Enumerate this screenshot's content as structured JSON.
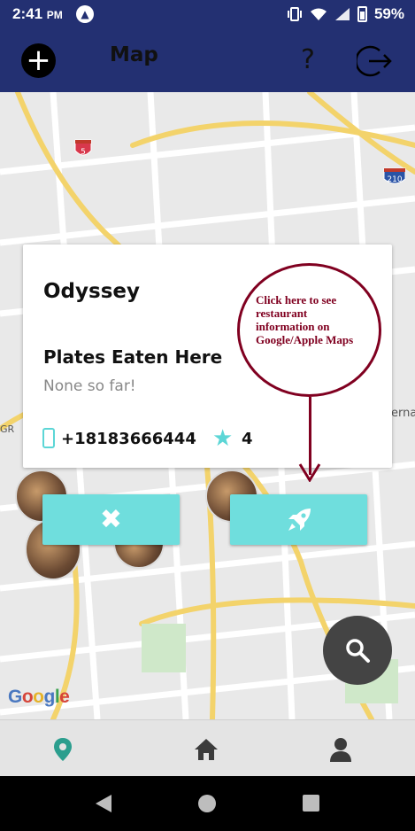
{
  "status_bar": {
    "time": "2:41",
    "ampm": "PM",
    "battery": "59%"
  },
  "header": {
    "title": "Map",
    "help_label": "?"
  },
  "map": {
    "shields": [
      "5",
      "210"
    ],
    "partial_label": "erna",
    "partial_label_left": "GR",
    "google": [
      "G",
      "o",
      "o",
      "g",
      "l",
      "e"
    ]
  },
  "card": {
    "name": "Odyssey",
    "plates_heading": "Plates Eaten Here",
    "plates_text": "None so far!",
    "phone": "+18183666444",
    "rating": "4"
  },
  "annotation": {
    "text": "Click here to see restaurant information on Google/Apple Maps"
  },
  "actions": {
    "close_symbol": "✖"
  },
  "colors": {
    "header": "#233072",
    "accent": "#6fdedd",
    "annotation": "#800020",
    "fab": "#444444"
  },
  "icons": {
    "add": "plus-circle-icon",
    "help": "question-icon",
    "logout": "logout-icon",
    "close": "x-icon",
    "maps": "rocket-icon",
    "search": "search-icon",
    "tab_map": "location-pin-icon",
    "tab_home": "home-icon",
    "tab_profile": "user-icon"
  }
}
